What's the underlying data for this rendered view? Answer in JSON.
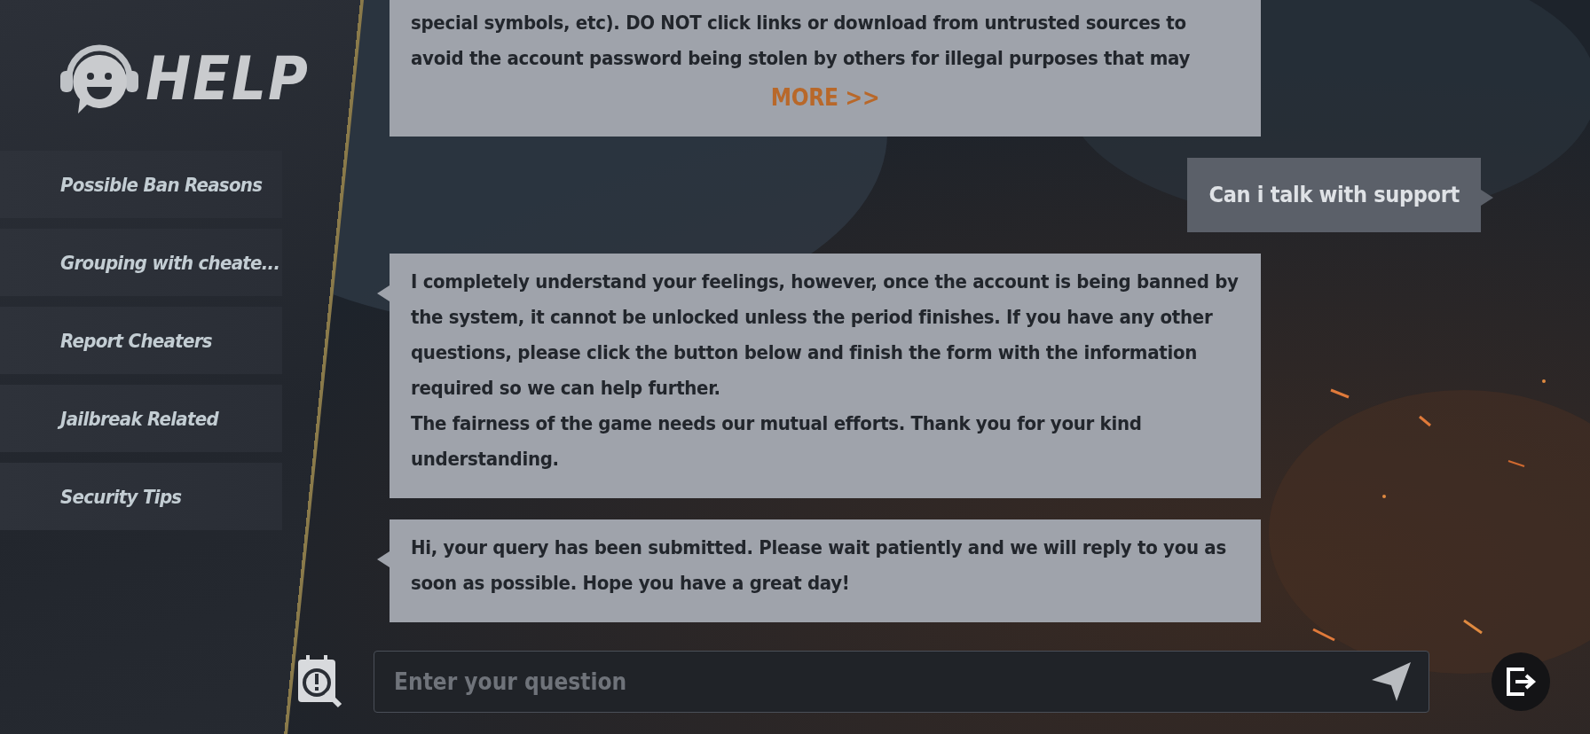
{
  "logo": {
    "title": "HELP"
  },
  "menu": [
    {
      "label": "Possible Ban Reasons"
    },
    {
      "label": "Grouping with cheate..."
    },
    {
      "label": "Report Cheaters"
    },
    {
      "label": "Jailbreak Related"
    },
    {
      "label": "Security Tips"
    }
  ],
  "messages": [
    {
      "kind": "bot",
      "paragraphs": [
        "special symbols, etc). DO NOT click links or download from untrusted sources to avoid the account password being stolen by others for illegal purposes that may"
      ],
      "more": "MORE >>"
    },
    {
      "kind": "user",
      "paragraphs": [
        "Can i talk with support"
      ]
    },
    {
      "kind": "bot",
      "paragraphs": [
        "I completely understand your feelings, however, once the account is being banned by the system, it cannot be unlocked unless the period finishes. If you have any other questions, please click the button below and finish the form with the information required so we can help further.",
        "The fairness of the game needs our mutual efforts. Thank you for your kind understanding."
      ]
    },
    {
      "kind": "bot",
      "paragraphs": [
        "Hi, your query has been submitted. Please wait patiently and we will reply to you as soon as possible. Hope you have a great day!"
      ]
    }
  ],
  "input": {
    "placeholder": "Enter your question"
  }
}
